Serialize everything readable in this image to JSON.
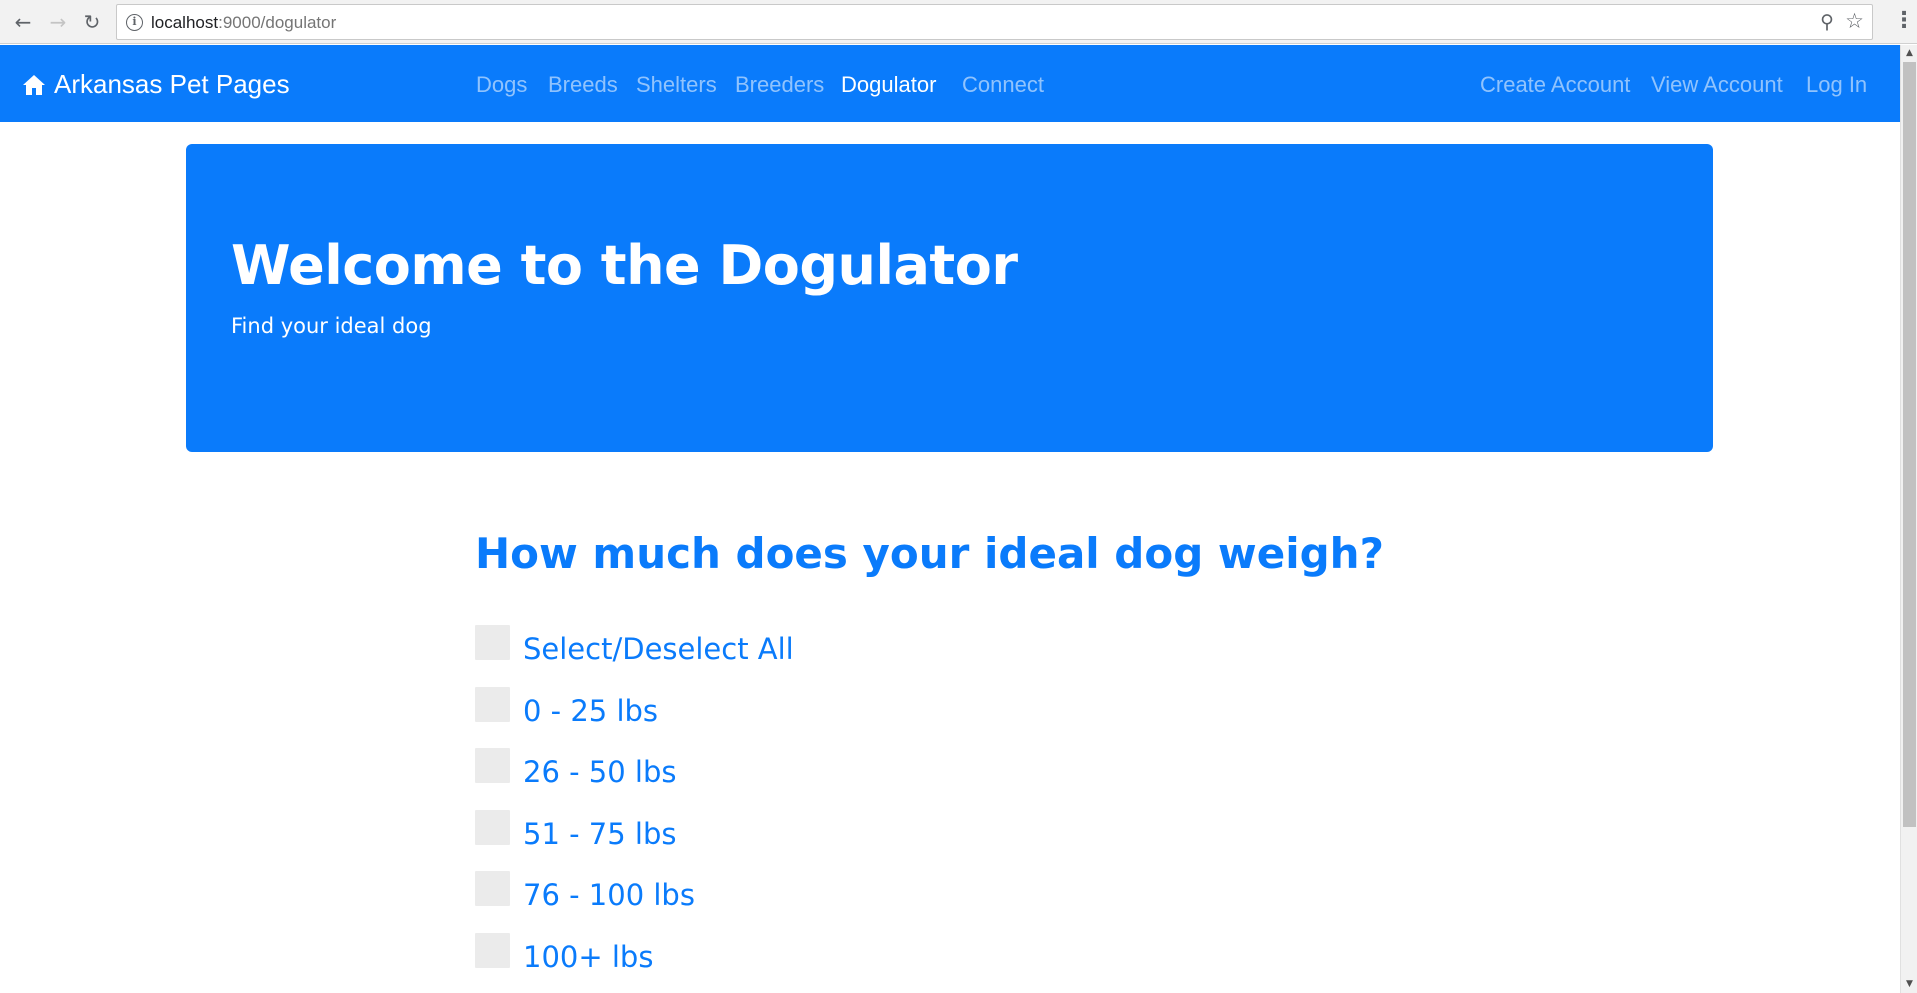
{
  "browser": {
    "url_host": "localhost",
    "url_rest": ":9000/dogulator"
  },
  "navbar": {
    "brand": "Arkansas Pet Pages",
    "links": [
      {
        "label": "Dogs",
        "active": false
      },
      {
        "label": "Breeds",
        "active": false
      },
      {
        "label": "Shelters",
        "active": false
      },
      {
        "label": "Breeders",
        "active": false
      },
      {
        "label": "Dogulator",
        "active": true
      },
      {
        "label": "Connect",
        "active": false
      }
    ],
    "account_links": [
      {
        "label": "Create Account"
      },
      {
        "label": "View Account"
      },
      {
        "label": "Log In"
      }
    ]
  },
  "jumbotron": {
    "title": "Welcome to the Dogulator",
    "subtitle": "Find your ideal dog"
  },
  "question": {
    "title": "How much does your ideal dog weigh?",
    "options": [
      {
        "label": "Select/Deselect All",
        "checked": false
      },
      {
        "label": "0 - 25 lbs",
        "checked": false
      },
      {
        "label": "26 - 50 lbs",
        "checked": false
      },
      {
        "label": "51 - 75 lbs",
        "checked": false
      },
      {
        "label": "76 - 100 lbs",
        "checked": false
      },
      {
        "label": "100+ lbs",
        "checked": false
      }
    ]
  },
  "colors": {
    "primary": "#0a7bfb",
    "checkbox": "#ebebeb"
  }
}
